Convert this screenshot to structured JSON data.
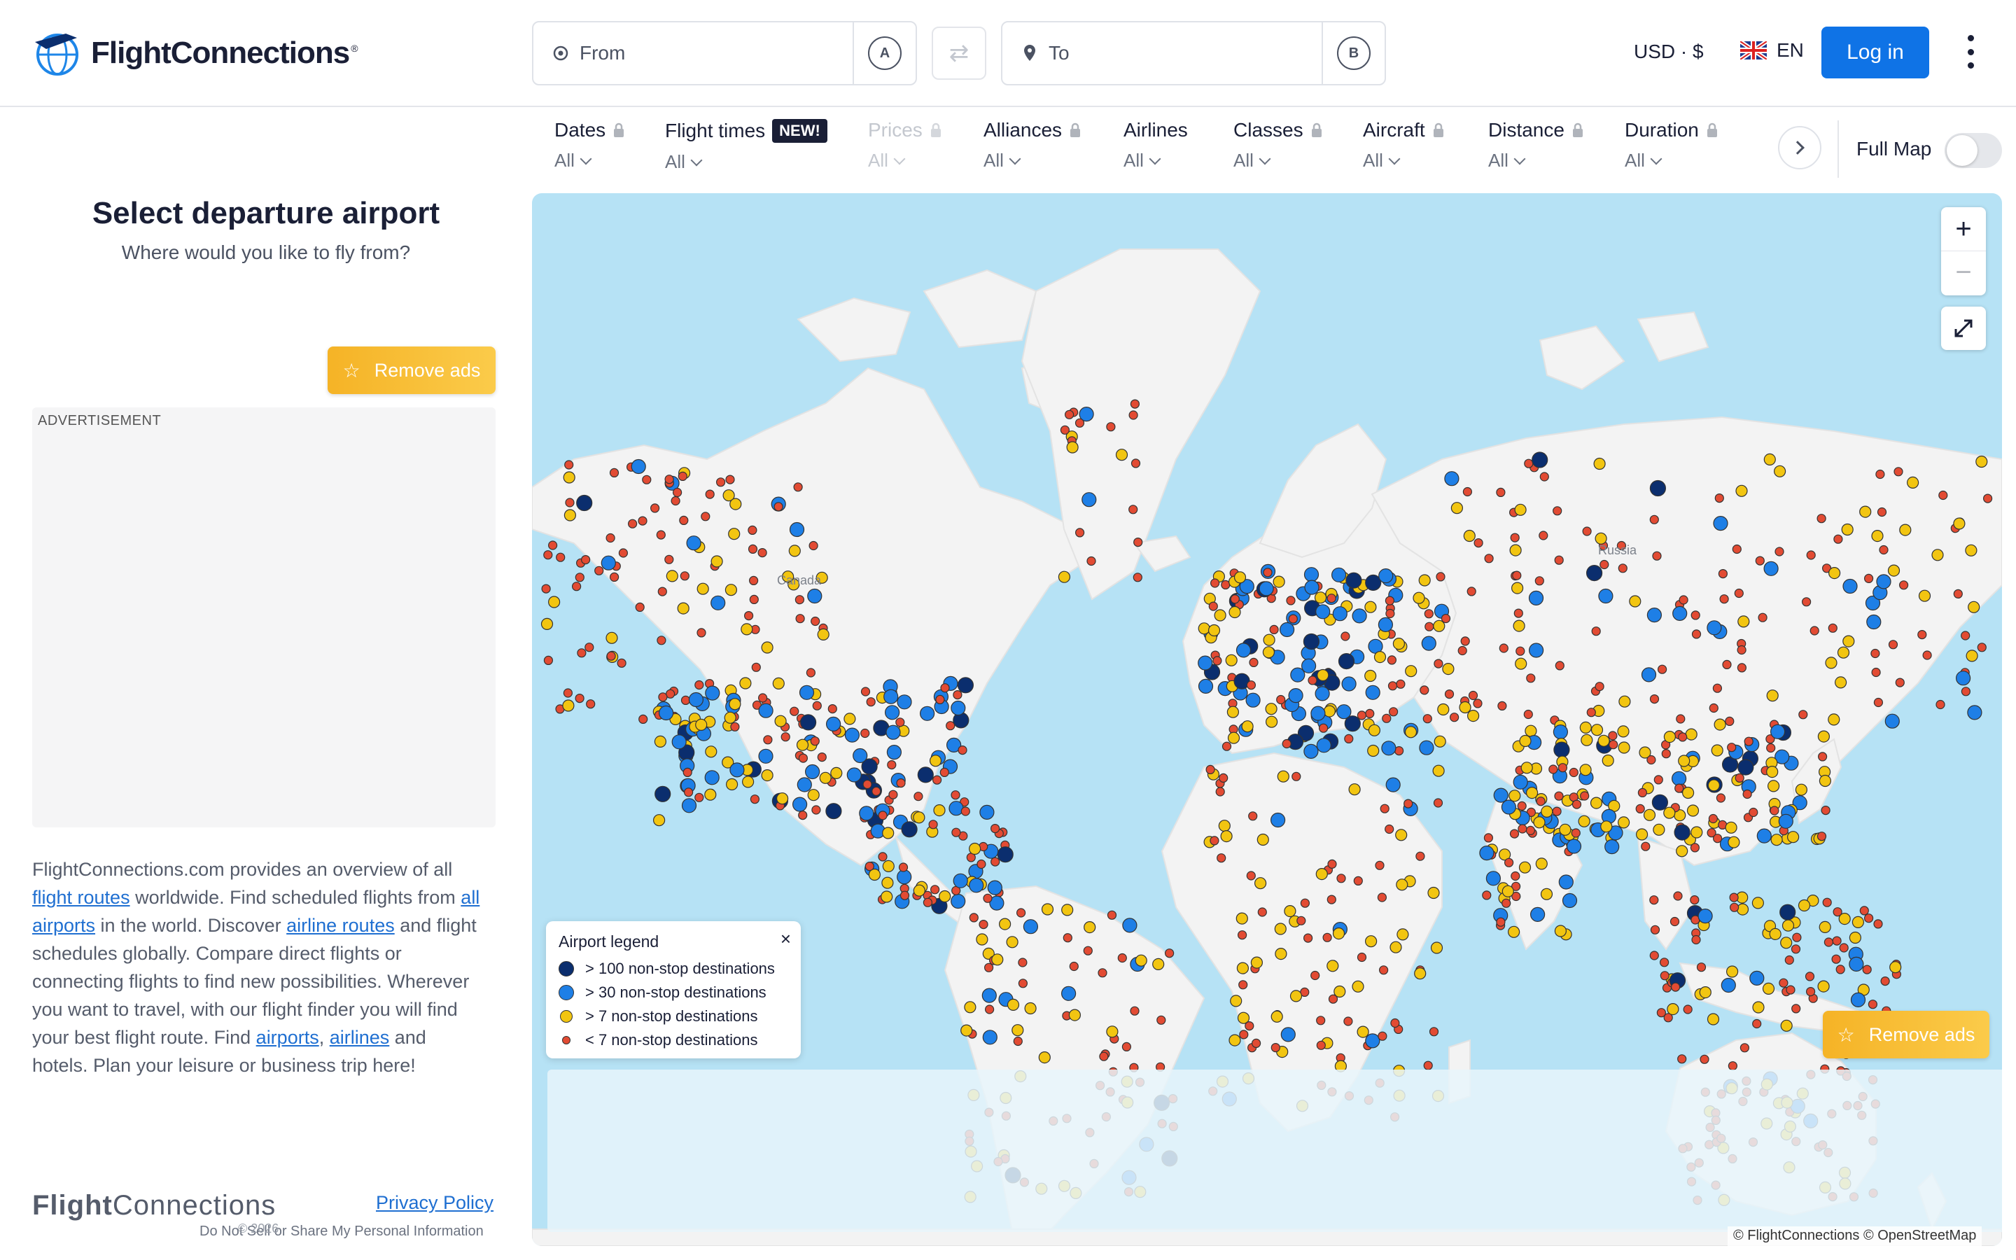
{
  "header": {
    "logo_text": "FlightConnections",
    "logo_reg": "®",
    "from_placeholder": "From",
    "from_badge": "A",
    "to_placeholder": "To",
    "to_badge": "B",
    "currency": "USD · $",
    "language": "EN",
    "login_label": "Log in"
  },
  "filters": [
    {
      "label": "Dates",
      "value": "All",
      "locked": true
    },
    {
      "label": "Flight times",
      "value": "All",
      "badge": "NEW!"
    },
    {
      "label": "Prices",
      "value": "All",
      "locked": true,
      "disabled": true
    },
    {
      "label": "Alliances",
      "value": "All",
      "locked": true
    },
    {
      "label": "Airlines",
      "value": "All"
    },
    {
      "label": "Classes",
      "value": "All",
      "locked": true
    },
    {
      "label": "Aircraft",
      "value": "All",
      "locked": true
    },
    {
      "label": "Distance",
      "value": "All",
      "locked": true
    },
    {
      "label": "Duration",
      "value": "All",
      "locked": true
    }
  ],
  "full_map_label": "Full Map",
  "sidebar": {
    "title": "Select departure airport",
    "subtitle": "Where would you like to fly from?",
    "remove_ads_label": "Remove ads",
    "ad_label": "ADVERTISEMENT",
    "about": {
      "t1": "FlightConnections.com provides an overview of all ",
      "link1": "flight routes",
      "t2": " worldwide. Find scheduled flights from ",
      "link2": "all airports",
      "t3": " in the world. Discover ",
      "link3": "airline routes",
      "t4": " and flight schedules globally. Compare direct flights or connecting flights to find new possibilities. Wherever you want to travel, with our flight finder you will find your best flight route. Find ",
      "link4": "airports",
      "t5": ", ",
      "link5": "airlines",
      "t6": " and hotels. Plan your leisure or business trip here!"
    },
    "footer_logo_bold": "Flight",
    "footer_logo_rest": "Connections",
    "copyright": "© 2026",
    "do_not_sell": "Do Not Sell or Share My Personal Information",
    "privacy_policy": "Privacy Policy"
  },
  "map": {
    "labels": {
      "canada": "Canada",
      "russia": "Russia"
    },
    "remove_ads_label": "Remove ads",
    "attribution": "© FlightConnections © OpenStreetMap",
    "legend": {
      "title": "Airport legend",
      "close": "×",
      "items": [
        {
          "label": "> 100 non-stop destinations",
          "color": "#0b2e6e"
        },
        {
          "label": "> 30 non-stop destinations",
          "color": "#1e7fe6"
        },
        {
          "label": "> 7 non-stop destinations",
          "color": "#f2c511"
        },
        {
          "label": "< 7 non-stop destinations",
          "color": "#e24b33"
        }
      ]
    }
  },
  "colors": {
    "accent": "#0f73e6",
    "ocean": "#b6e2f5",
    "land": "#f2f2f2",
    "remove_ads": "#f7b731"
  }
}
